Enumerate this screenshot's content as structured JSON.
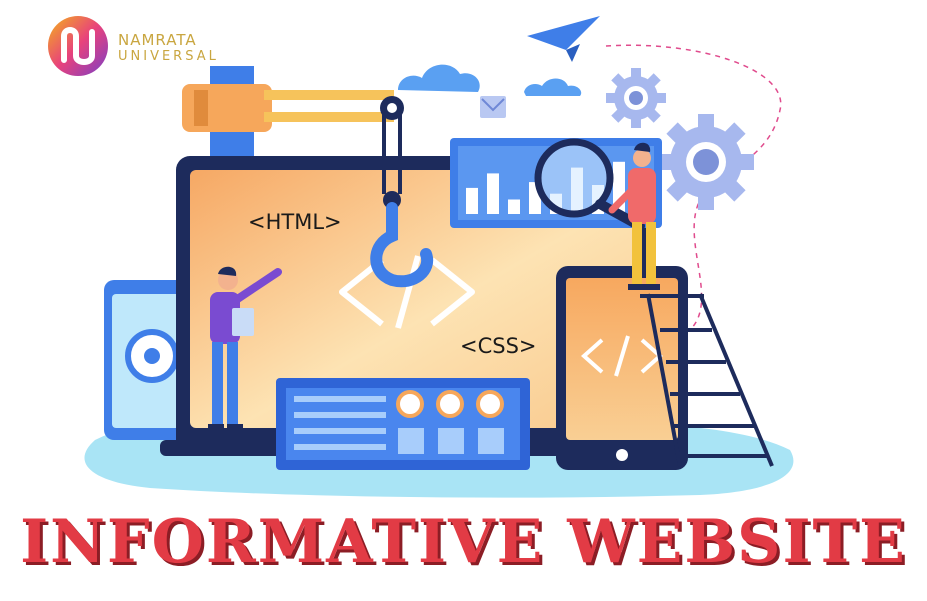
{
  "brand": {
    "line1": "NAMRATA",
    "line2": "UNIVERSAL"
  },
  "illustration": {
    "html_label": "<HTML>",
    "css_label": "<CSS>",
    "code_symbol": "</>",
    "bar_chart_values": [
      0.45,
      0.7,
      0.25,
      0.55,
      0.35,
      0.8,
      0.5,
      0.9,
      0.6
    ]
  },
  "colors": {
    "headline": "#e23b45",
    "primary_blue": "#3f7ee8",
    "dark_navy": "#1d2b5c",
    "screen_orange": "#f6b26b",
    "brand_gold": "#c9a640"
  },
  "headline": "INFORMATIVE WEBSITE"
}
